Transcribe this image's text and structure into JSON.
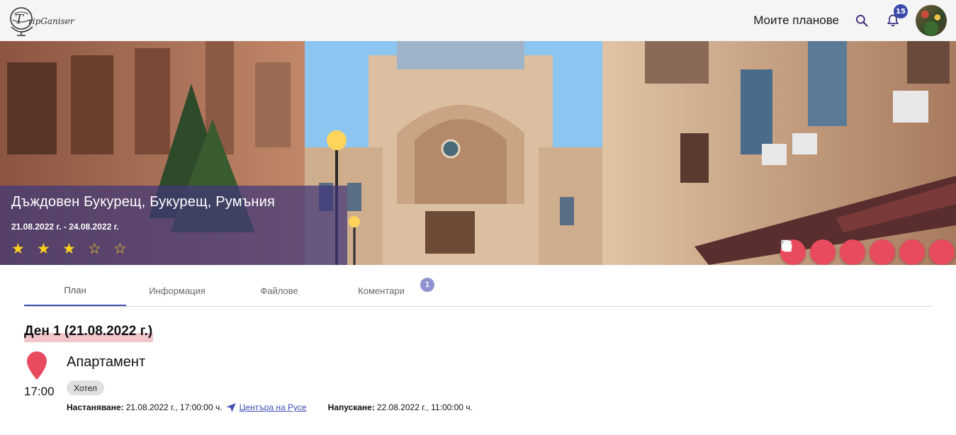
{
  "header": {
    "logo_text": "ripGaniser",
    "my_plans": "Моите планове",
    "notifications_count": "15",
    "icons": [
      "search-icon",
      "bell-icon"
    ]
  },
  "hero": {
    "title": "Дъждовен Букурещ, Букурещ, Румъния",
    "dates": "21.08.2022 г. - 24.08.2022 г.",
    "rating": 3,
    "rating_max": 5,
    "stars": [
      "★",
      "★",
      "★",
      "☆",
      "☆"
    ],
    "actions": [
      "edit-icon",
      "flag-icon",
      "print-icon",
      "share-icon",
      "copy-icon",
      "delete-icon"
    ]
  },
  "tabs": [
    {
      "label": "План",
      "active": true
    },
    {
      "label": "Информация"
    },
    {
      "label": "Файлове"
    },
    {
      "label": "Коментари",
      "badge": "1"
    }
  ],
  "day": {
    "title": "Ден 1 (21.08.2022 г.)",
    "item": {
      "time": "17:00",
      "title": "Апартамент",
      "category": "Хотел",
      "checkin_label": "Настаняване:",
      "checkin_value": "21.08.2022 г., 17:00:00 ч.",
      "location": "Центъра на Русе",
      "checkout_label": "Напускане:",
      "checkout_value": "22.08.2022 г., 11:00:00 ч."
    }
  },
  "colors": {
    "accent": "#3d4fb3",
    "action": "#e84b5e",
    "star": "#ffd21f",
    "overlay": "#403878"
  }
}
